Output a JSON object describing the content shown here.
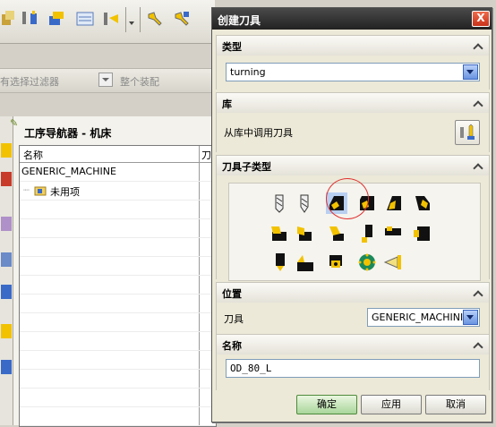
{
  "background": {
    "filter_placeholder": "有选择过滤器",
    "assembly_filter": "整个装配",
    "navigator": {
      "title": "工序导航器 - 机床",
      "col_name": "名称",
      "col_second": "刀",
      "rows": [
        {
          "label": "GENERIC_MACHINE"
        },
        {
          "label": "未用项"
        }
      ]
    }
  },
  "dialog": {
    "title": "创建刀具",
    "close_label": "X",
    "type_section": {
      "header": "类型",
      "value": "turning"
    },
    "library_section": {
      "header": "库",
      "label": "从库中调用刀具"
    },
    "subtype_section": {
      "header": "刀具子类型"
    },
    "location_section": {
      "header": "位置",
      "label": "刀具",
      "value": "GENERIC_MACHINI"
    },
    "name_section": {
      "header": "名称",
      "value": "OD_80_L"
    },
    "buttons": {
      "ok": "确定",
      "apply": "应用",
      "cancel": "取消"
    }
  },
  "colors": {
    "title_bg": "#2a2a2a",
    "tool_yellow": "#f2c200",
    "ok_green": "#a9d69a",
    "circle_red": "#e03030"
  }
}
